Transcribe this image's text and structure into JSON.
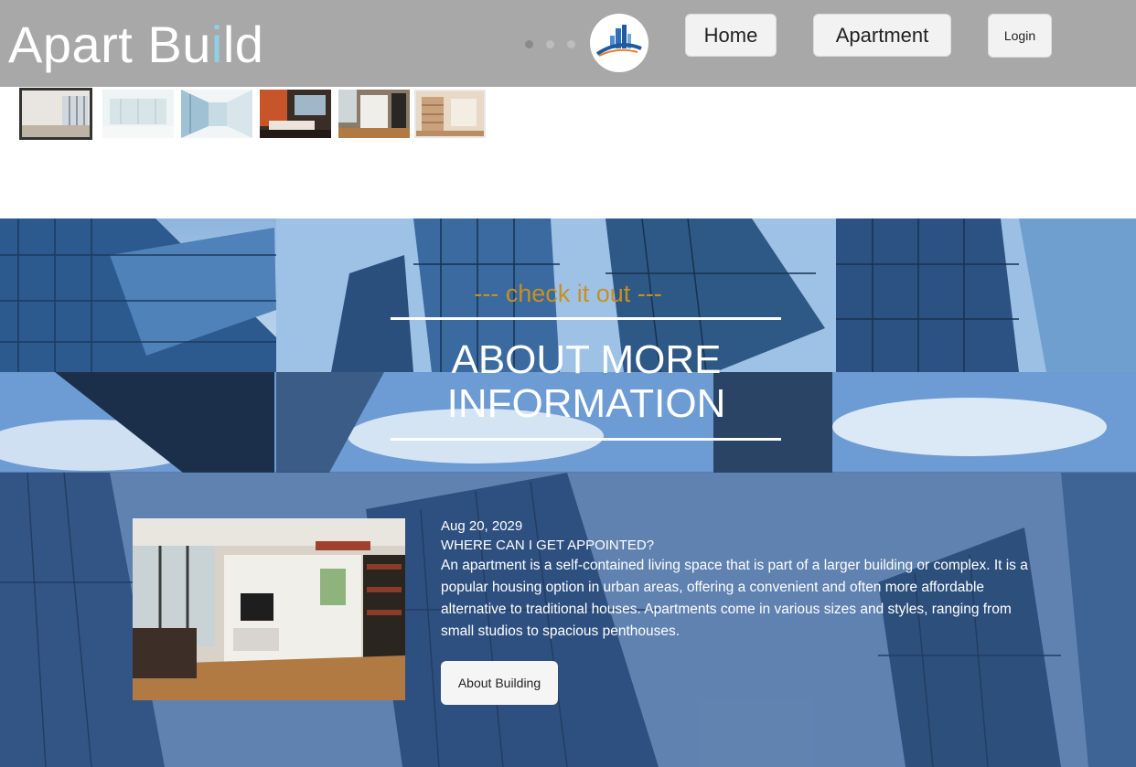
{
  "header": {
    "brand_prefix": "Apart Bu",
    "brand_accent": "i",
    "brand_suffix": "ld",
    "nav": {
      "home_label": "Home",
      "apartment_label": "Apartment",
      "login_label": "Login"
    },
    "carousel_dots": 3
  },
  "thumbnails": [
    {
      "name": "empty-room"
    },
    {
      "name": "white-office"
    },
    {
      "name": "glass-corridor"
    },
    {
      "name": "orange-living-room"
    },
    {
      "name": "studio-interior"
    },
    {
      "name": "loft-shelves"
    }
  ],
  "hero": {
    "subtitle": "--- check it out ---",
    "title_line1": "ABOUT MORE",
    "title_line2": "INFORMATION"
  },
  "post": {
    "date": "Aug 20, 2029",
    "heading": "WHERE CAN I GET APPOINTED?",
    "body": "An apartment is a self-contained living space that is part of a larger building or complex. It is a popular housing option in urban areas, offering a convenient and often more affordable alternative to traditional houses. Apartments come in various sizes and styles, ranging from small studios to spacious penthouses.",
    "button_label": "About Building"
  },
  "colors": {
    "header_bg": "#a8a8a8",
    "subtitle": "#c8901e",
    "sky": "#5f86b8"
  }
}
